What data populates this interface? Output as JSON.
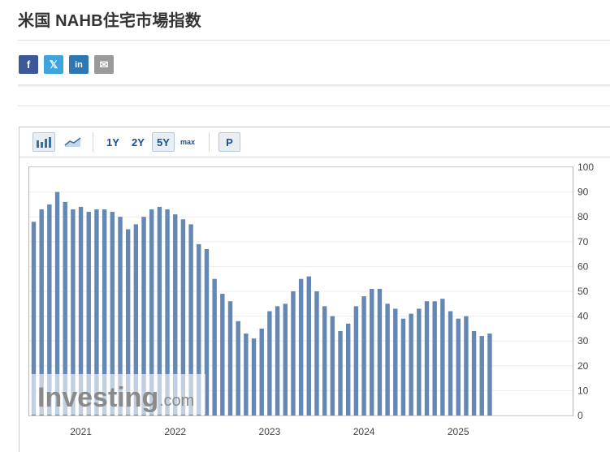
{
  "page": {
    "title": "米国 NAHB住宅市場指数"
  },
  "share": [
    {
      "name": "facebook",
      "glyph": "f"
    },
    {
      "name": "twitter",
      "glyph": "𝕏"
    },
    {
      "name": "linkedin",
      "glyph": "in"
    },
    {
      "name": "email",
      "glyph": "✉"
    }
  ],
  "toolbar": {
    "ranges": [
      "1Y",
      "2Y",
      "5Y",
      "max"
    ],
    "active_range": "5Y",
    "p_label": "P"
  },
  "watermark": {
    "brand": "Investing",
    "suffix": ".com"
  },
  "colors": {
    "bar": "#6487b4",
    "accent": "#1a4e95",
    "grid": "#ececec"
  },
  "chart_data": {
    "type": "bar",
    "title": "",
    "xlabel": "",
    "ylabel": "",
    "ylim": [
      0,
      100
    ],
    "yticks": [
      0,
      10,
      20,
      30,
      40,
      50,
      60,
      70,
      80,
      90,
      100
    ],
    "xtick_labels": [
      "2021",
      "2022",
      "2023",
      "2024",
      "2025"
    ],
    "grid": true,
    "y_axis_position": "right",
    "categories": [
      "2020-12",
      "2021-01",
      "2021-02",
      "2021-03",
      "2021-04",
      "2021-05",
      "2021-06",
      "2021-07",
      "2021-08",
      "2021-09",
      "2021-10",
      "2021-11",
      "2021-12",
      "2022-01",
      "2022-02",
      "2022-03",
      "2022-04",
      "2022-05",
      "2022-06",
      "2022-07",
      "2022-08",
      "2022-09",
      "2022-10",
      "2022-11",
      "2022-12",
      "2023-01",
      "2023-02",
      "2023-03",
      "2023-04",
      "2023-05",
      "2023-06",
      "2023-07",
      "2023-08",
      "2023-09",
      "2023-10",
      "2023-11",
      "2023-12",
      "2024-01",
      "2024-02",
      "2024-03",
      "2024-04",
      "2024-05",
      "2024-06",
      "2024-07",
      "2024-08",
      "2024-09",
      "2024-10",
      "2024-11",
      "2024-12",
      "2025-01",
      "2025-02",
      "2025-03",
      "2025-04",
      "2025-05",
      "2025-06",
      "2025-07",
      "2025-08",
      "2025-09",
      "2025-10",
      "2025-11",
      "2025-12"
    ],
    "values": [
      78,
      83,
      85,
      90,
      86,
      83,
      84,
      82,
      83,
      83,
      82,
      80,
      75,
      77,
      80,
      83,
      84,
      83,
      81,
      79,
      77,
      69,
      67,
      55,
      49,
      46,
      38,
      33,
      31,
      35,
      42,
      44,
      45,
      50,
      55,
      56,
      50,
      44,
      40,
      34,
      37,
      44,
      48,
      51,
      51,
      45,
      43,
      39,
      41,
      43,
      46,
      46,
      47,
      42,
      39,
      40,
      34,
      32,
      33
    ]
  }
}
